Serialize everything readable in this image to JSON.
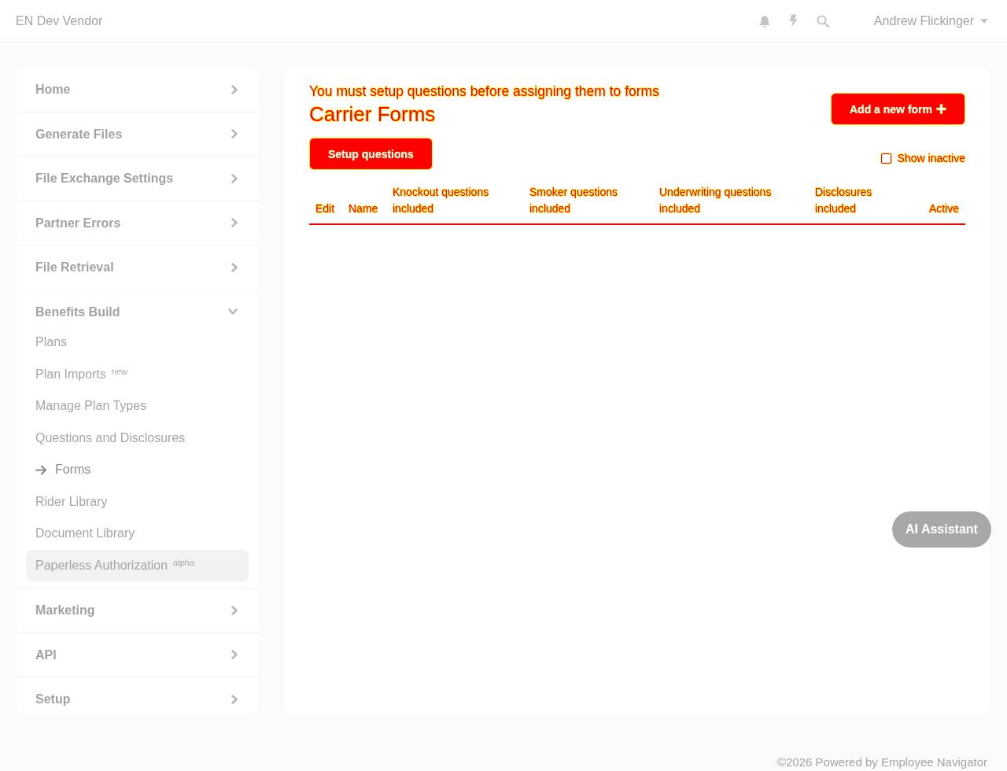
{
  "topbar": {
    "brand": "EN Dev Vendor",
    "user": "Andrew Flickinger"
  },
  "sidebar": {
    "items": [
      {
        "label": "Home",
        "expanded": false
      },
      {
        "label": "Generate Files",
        "expanded": false
      },
      {
        "label": "File Exchange Settings",
        "expanded": false
      },
      {
        "label": "Partner Errors",
        "expanded": false
      },
      {
        "label": "File Retrieval",
        "expanded": false
      },
      {
        "label": "Benefits Build",
        "expanded": true,
        "children": [
          {
            "label": "Plans",
            "selected": false,
            "hovered": false
          },
          {
            "label": "Plan Imports",
            "badge": "new",
            "selected": false,
            "hovered": false
          },
          {
            "label": "Manage Plan Types",
            "selected": false,
            "hovered": false
          },
          {
            "label": "Questions and Disclosures",
            "selected": false,
            "hovered": false
          },
          {
            "label": "Forms",
            "selected": true,
            "hovered": false
          },
          {
            "label": "Rider Library",
            "selected": false,
            "hovered": false
          },
          {
            "label": "Document Library",
            "selected": false,
            "hovered": false
          },
          {
            "label": "Paperless Authorization",
            "badge": "alpha",
            "selected": false,
            "hovered": true
          }
        ]
      },
      {
        "label": "Marketing",
        "expanded": false
      },
      {
        "label": "API",
        "expanded": false
      },
      {
        "label": "Setup",
        "expanded": false
      }
    ]
  },
  "main": {
    "alert": "You must setup questions before assigning them to forms",
    "title": "Carrier Forms",
    "add_button": "Add a new form",
    "setup_button": "Setup questions",
    "show_inactive": {
      "label": "Show inactive",
      "checked": false
    },
    "table": {
      "columns": [
        "Edit",
        "Name",
        "Knockout questions included",
        "Smoker questions included",
        "Underwriting questions included",
        "Disclosures included",
        "Active"
      ]
    }
  },
  "assistant_button": "AI Assistant",
  "footer": "©2026 Powered by Employee Navigator"
}
